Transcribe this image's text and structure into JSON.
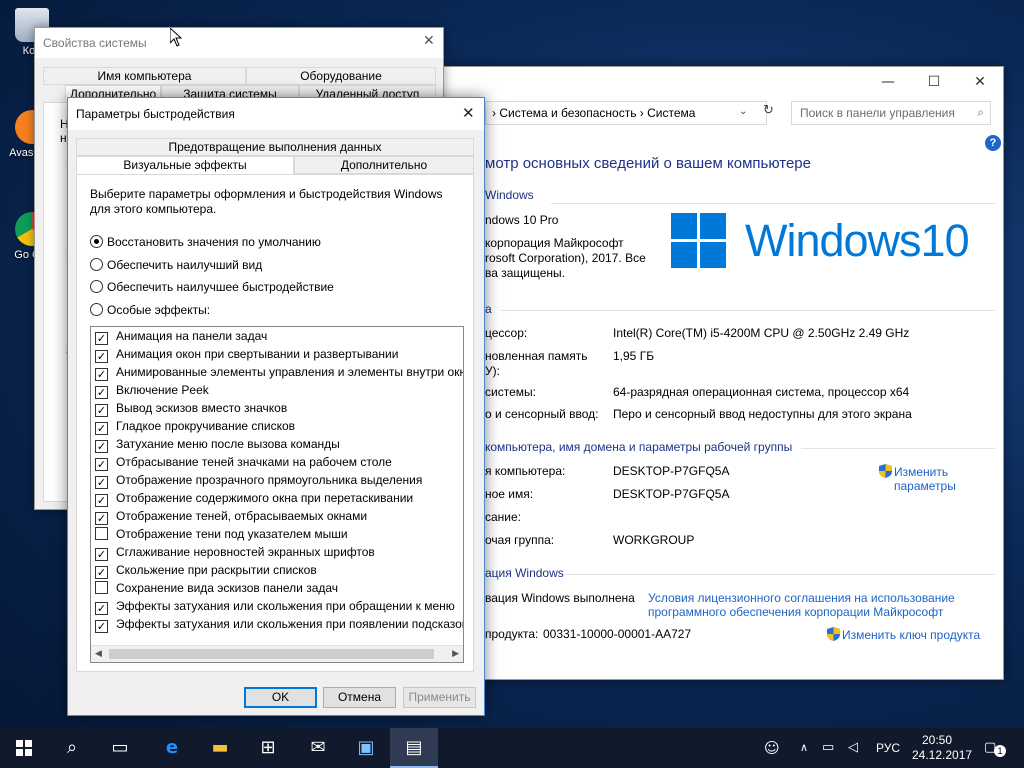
{
  "desktop": {
    "icons": [
      {
        "label": "Кор"
      },
      {
        "label": "Avas Anti"
      },
      {
        "label": "Go Chr"
      }
    ]
  },
  "system_window": {
    "address": [
      "Система и безопасность",
      "Система"
    ],
    "search_placeholder": "Поиск в панели управления",
    "heading": "мотр основных сведений о вашем компьютере",
    "section_edition": "Windows",
    "edition": "ndows 10 Pro",
    "copyright_line1": "корпорация Майкрософт",
    "copyright_line2": "rosoft Corporation), 2017. Все",
    "copyright_line3": "ва защищены.",
    "logo_text": "Windows10",
    "section_system": "а",
    "processor_label": "цессор:",
    "processor_value": "Intel(R) Core(TM) i5-4200M CPU @ 2.50GHz   2.49 GHz",
    "ram_label": "новленная память",
    "ram_label2": "У):",
    "ram_value": "1,95 ГБ",
    "type_label": "системы:",
    "type_value": "64-разрядная операционная система, процессор x64",
    "pen_label": "о и сенсорный ввод:",
    "pen_value": "Перо и сенсорный ввод недоступны для этого экрана",
    "section_name": "компьютера, имя домена и параметры рабочей группы",
    "pcname_label": "я компьютера:",
    "pcname_value": "DESKTOP-P7GFQ5A",
    "fullname_label": "ное имя:",
    "fullname_value": "DESKTOP-P7GFQ5A",
    "desc_label": "сание:",
    "wg_label": "очая группа:",
    "wg_value": "WORKGROUP",
    "change_link1": "Изменить",
    "change_link2": "параметры",
    "section_activation": "ация Windows",
    "act_label": "вация Windows выполнена",
    "license_link1": "Условия лицензионного соглашения на использование",
    "license_link2": "программного обеспечения корпорации Майкрософт",
    "prodkey_label": "продукта:",
    "prodkey_value": "00331-10000-00001-AA727",
    "change_key_link": "Изменить ключ продукта"
  },
  "props_window": {
    "title": "Свойства системы",
    "tabs_row1": [
      "Имя компьютера",
      "Оборудование"
    ],
    "tabs_row2": [
      "Дополнительно",
      "Защита системы",
      "Удаленный доступ"
    ],
    "frag1": "Н",
    "frag2": "н",
    "frag3": "В",
    "frag4": "П",
    "frag5": "З"
  },
  "perf_dialog": {
    "title": "Параметры быстродействия",
    "tab_top": "Предотвращение выполнения данных",
    "tab_visual": "Визуальные эффекты",
    "tab_advanced": "Дополнительно",
    "intro_line1": "Выберите параметры оформления и быстродействия Windows",
    "intro_line2": "для этого компьютера.",
    "radios": [
      {
        "label": "Восстановить значения по умолчанию",
        "selected": true
      },
      {
        "label": "Обеспечить наилучший вид",
        "selected": false
      },
      {
        "label": "Обеспечить наилучшее быстродействие",
        "selected": false
      },
      {
        "label": "Особые эффекты:",
        "selected": false
      }
    ],
    "effects": [
      {
        "label": "Анимация на панели задач",
        "checked": true
      },
      {
        "label": "Анимация окон при свертывании и развертывании",
        "checked": true
      },
      {
        "label": "Анимированные элементы управления и элементы внутри окн",
        "checked": true
      },
      {
        "label": "Включение Peek",
        "checked": true
      },
      {
        "label": "Вывод эскизов вместо значков",
        "checked": true
      },
      {
        "label": "Гладкое прокручивание списков",
        "checked": true
      },
      {
        "label": "Затухание меню после вызова команды",
        "checked": true
      },
      {
        "label": "Отбрасывание теней значками на рабочем столе",
        "checked": true
      },
      {
        "label": "Отображение прозрачного прямоугольника выделения",
        "checked": true
      },
      {
        "label": "Отображение содержимого окна при перетаскивании",
        "checked": true
      },
      {
        "label": "Отображение теней, отбрасываемых окнами",
        "checked": true
      },
      {
        "label": "Отображение тени под указателем мыши",
        "checked": false
      },
      {
        "label": "Сглаживание неровностей экранных шрифтов",
        "checked": true
      },
      {
        "label": "Скольжение при раскрытии списков",
        "checked": true
      },
      {
        "label": "Сохранение вида эскизов панели задач",
        "checked": false
      },
      {
        "label": "Эффекты затухания или скольжения при обращении к меню",
        "checked": true
      },
      {
        "label": "Эффекты затухания или скольжения при появлении подсказок",
        "checked": true
      }
    ],
    "ok": "OK",
    "cancel": "Отмена",
    "apply": "Применить"
  },
  "taskbar": {
    "lang": "РУС",
    "time": "20:50",
    "date": "24.12.2017",
    "notif_count": "1"
  },
  "colors": {
    "accent": "#0078d7",
    "link": "#1e64c8",
    "taskbar": "#101a2c"
  }
}
